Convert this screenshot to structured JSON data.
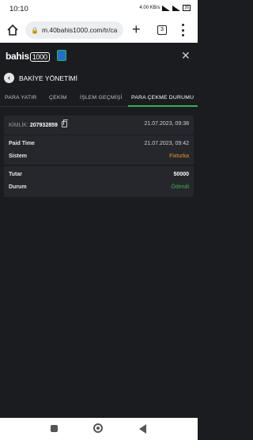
{
  "status": {
    "time": "10:10",
    "net": "4.00 KB/s",
    "battery": "26"
  },
  "browser": {
    "url": "m.40bahis1000.com/tr/ca",
    "tab_count": "3"
  },
  "site": {
    "logo_text": "bahis",
    "logo_num": "1000"
  },
  "section": {
    "title": "BAKİYE YÖNETİMİ"
  },
  "tabs": [
    {
      "label": "PARA YATIR"
    },
    {
      "label": "ÇEKİM"
    },
    {
      "label": "İŞLEM GEÇMİŞİ"
    },
    {
      "label": "PARA ÇEKME DURUMU",
      "active": true
    }
  ],
  "record": {
    "id_label": "KİMLİK:",
    "id_value": "207932859",
    "created": "21.07.2023, 09:38",
    "paid_time_label": "Paid Time",
    "paid_time": "21.07.2023, 09:42",
    "system_label": "Sistem",
    "system": "Fixturka",
    "amount_label": "Tutar",
    "amount": "50000",
    "status_label": "Durum",
    "status": "Ödendi"
  },
  "colors": {
    "accent": "#2fb34b",
    "system": "#e2962a",
    "background": "#1b1c20",
    "card": "#26272c"
  }
}
